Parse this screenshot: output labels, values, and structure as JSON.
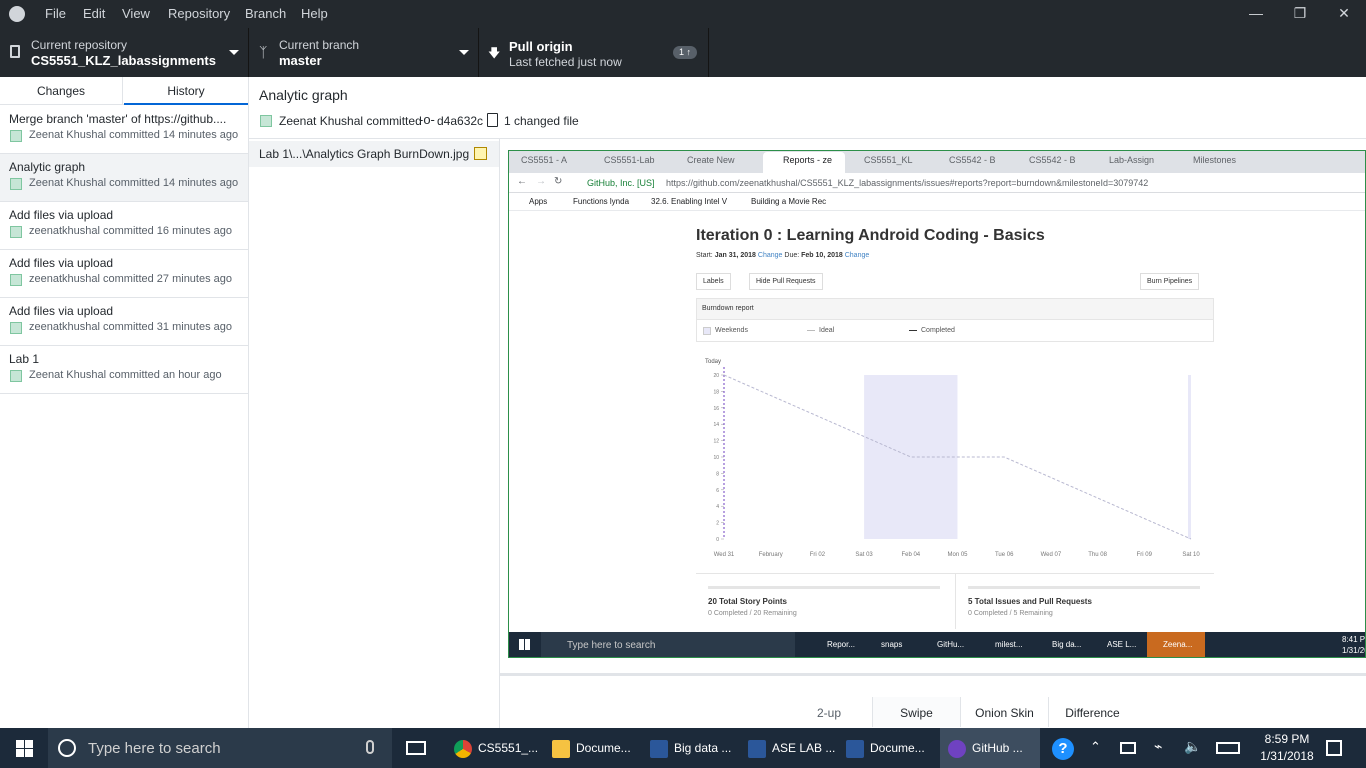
{
  "menu": [
    "File",
    "Edit",
    "View",
    "Repository",
    "Branch",
    "Help"
  ],
  "toolbar": {
    "repo_label": "Current repository",
    "repo_name": "CS5551_KLZ_labassignments",
    "branch_label": "Current branch",
    "branch_name": "master",
    "pull_label": "Pull origin",
    "pull_sub": "Last fetched just now",
    "pull_badge": "1 ↑"
  },
  "tabs": {
    "changes": "Changes",
    "history": "History"
  },
  "commits": [
    {
      "title": "Merge branch 'master' of https://github....",
      "meta": "Zeenat Khushal committed 14 minutes ago"
    },
    {
      "title": "Analytic graph",
      "meta": "Zeenat Khushal committed 14 minutes ago"
    },
    {
      "title": "Add files via upload",
      "meta": "zeenatkhushal committed 16 minutes ago"
    },
    {
      "title": "Add files via upload",
      "meta": "zeenatkhushal committed 27 minutes ago"
    },
    {
      "title": "Add files via upload",
      "meta": "zeenatkhushal committed 31 minutes ago"
    },
    {
      "title": "Lab 1",
      "meta": "Zeenat Khushal committed an hour ago"
    }
  ],
  "commit_detail": {
    "title": "Analytic graph",
    "author": "Zeenat Khushal committed",
    "sha": "d4a632c",
    "changed": "1 changed file"
  },
  "file": {
    "path": "Lab 1\\...\\Analytics Graph BurnDown.jpg"
  },
  "browser": {
    "tabs": [
      "CS5551 - A",
      "CS5551-Lab",
      "Create New",
      "Reports - ze",
      "CS5551_KL",
      "CS5542 - B",
      "CS5542 - B",
      "Lab-Assign",
      "Milestones"
    ],
    "secure": "GitHub, Inc. [US]",
    "url": "https://github.com/zeenatkhushal/CS5551_KLZ_labassignments/issues#reports?report=burndown&milestoneId=3079742",
    "bookmarks": [
      "Apps",
      "Functions lynda",
      "32.6. Enabling Intel V",
      "Building a Movie Rec"
    ]
  },
  "report": {
    "heading": "Iteration 0 : Learning Android Coding - Basics",
    "start_label": "Start:",
    "start": "Jan 31, 2018",
    "change": "Change",
    "due_label": "Due:",
    "due": "Feb 10, 2018",
    "labels_btn": "Labels",
    "hide_pr_btn": "Hide Pull Requests",
    "pipelines_btn": "Burn Pipelines",
    "panel_title": "Burndown report",
    "legend": [
      "Weekends",
      "Ideal",
      "Completed"
    ],
    "today": "Today",
    "story_points": "20 Total Story Points",
    "sp_sub": "0 Completed / 20 Remaining",
    "issues": "5 Total Issues and Pull Requests",
    "issues_sub": "0 Completed / 5 Remaining"
  },
  "chart_data": {
    "type": "line",
    "x": [
      "Wed 31",
      "February",
      "Fri 02",
      "Sat 03",
      "Feb 04",
      "Mon 05",
      "Tue 06",
      "Wed 07",
      "Thu 08",
      "Fri 09",
      "Sat 10"
    ],
    "y_ticks": [
      "20",
      "18",
      "16",
      "14",
      "12",
      "10",
      "8",
      "6",
      "4",
      "2",
      "0"
    ],
    "series": [
      {
        "name": "Ideal",
        "values": [
          20,
          17.5,
          15,
          12.5,
          10,
          10,
          10,
          7.5,
          5,
          2.5,
          0
        ]
      }
    ],
    "ylim": [
      0,
      20
    ],
    "weekend_shade": [
      "Sat 03",
      "Feb 04"
    ]
  },
  "inner_taskbar": {
    "search": "Type here to search",
    "items": [
      "Repor...",
      "snaps",
      "GitHu...",
      "milest...",
      "Big da...",
      "ASE L...",
      "Zeena..."
    ],
    "time": "8:41 P",
    "date": "1/31/20"
  },
  "view_modes": [
    "2-up",
    "Swipe",
    "Onion Skin",
    "Difference"
  ],
  "taskbar": {
    "search": "Type here to search",
    "items": [
      "CS5551_...",
      "Docume...",
      "Big data ...",
      "ASE LAB ...",
      "Docume...",
      "GitHub ..."
    ],
    "time": "8:59 PM",
    "date": "1/31/2018"
  },
  "colors": {
    "accent": "#0366d6",
    "dark": "#24292e",
    "taskbar": "#1c2a3a"
  }
}
